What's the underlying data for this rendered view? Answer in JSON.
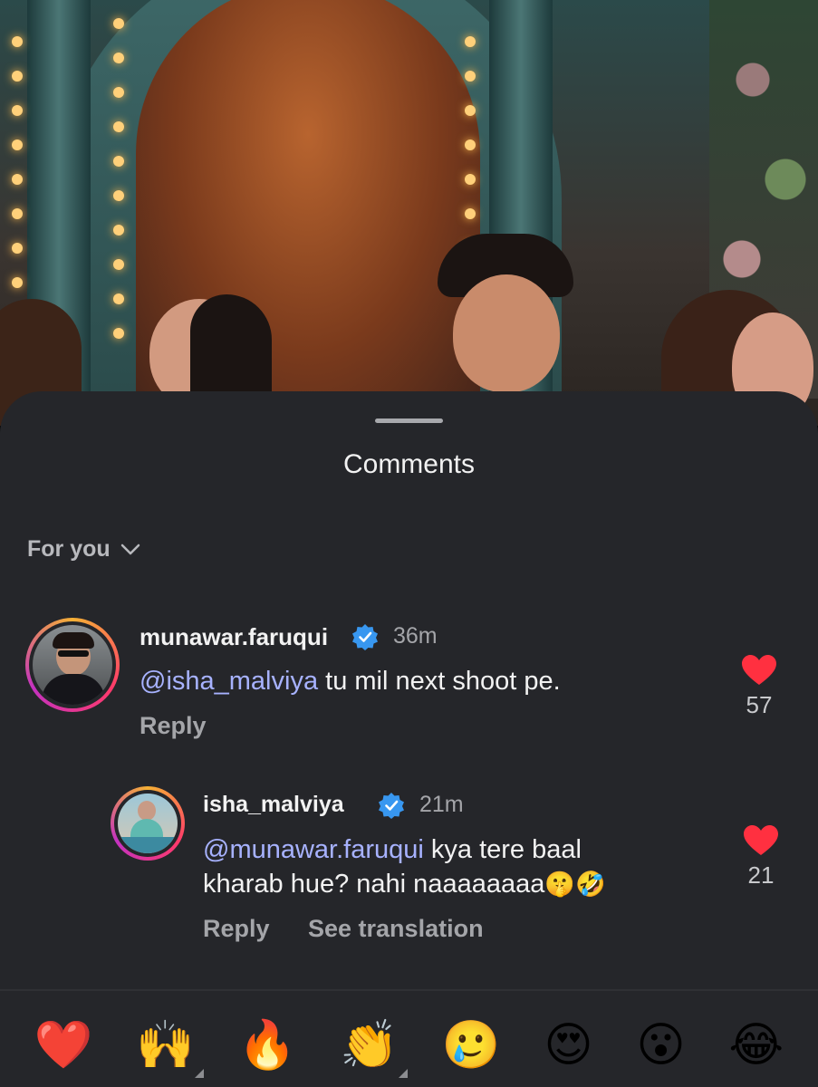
{
  "sheet": {
    "title": "Comments",
    "filter_label": "For you"
  },
  "comments": [
    {
      "username": "munawar.faruqui",
      "verified": true,
      "time": "36m",
      "mention": "@isha_malviya",
      "text": " tu mil next shoot pe.",
      "reply_label": "Reply",
      "likes": "57"
    },
    {
      "username": "isha_malviya",
      "verified": true,
      "time": "21m",
      "mention": "@munawar.faruqui",
      "text_line1": " kya tere baal",
      "text_line2": "kharab hue? nahi naaaaaaaa",
      "emoji_suffix": "🤫🤣",
      "reply_label": "Reply",
      "translate_label": "See translation",
      "likes": "21"
    }
  ],
  "reactions": [
    {
      "name": "heart",
      "glyph": "❤️",
      "has_variants": false
    },
    {
      "name": "raising-hands",
      "glyph": "🙌",
      "has_variants": true
    },
    {
      "name": "fire",
      "glyph": "🔥",
      "has_variants": false
    },
    {
      "name": "clapping-hands",
      "glyph": "👏",
      "has_variants": true
    },
    {
      "name": "crying-face",
      "glyph": "🥲",
      "has_variants": false
    },
    {
      "name": "heart-eyes",
      "glyph": "😍",
      "has_variants": false
    },
    {
      "name": "surprised-face",
      "glyph": "😮",
      "has_variants": false
    },
    {
      "name": "tears-of-joy",
      "glyph": "😂",
      "has_variants": false
    }
  ],
  "colors": {
    "sheet_bg": "#25262a",
    "mention": "#a7b2ff",
    "like_red": "#ff3040",
    "verified_blue": "#3897f0"
  }
}
